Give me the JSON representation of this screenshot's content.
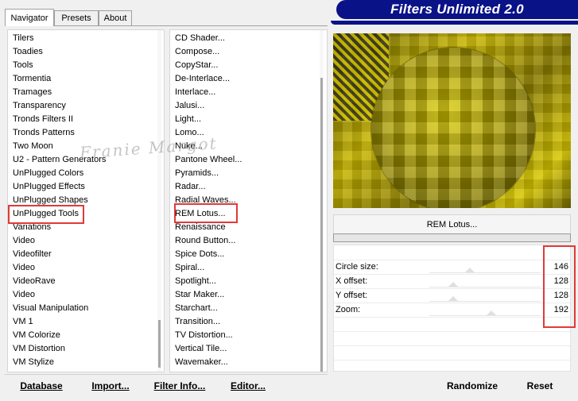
{
  "tabs": [
    {
      "label": "Navigator",
      "active": true
    },
    {
      "label": "Presets",
      "active": false
    },
    {
      "label": "About",
      "active": false
    }
  ],
  "banner": {
    "title": "Filters Unlimited 2.0"
  },
  "categories": [
    "Tilers",
    "Toadies",
    "Tools",
    "Tormentia",
    "Tramages",
    "Transparency",
    "Tronds Filters II",
    "Tronds Patterns",
    "Two Moon",
    "U2 - Pattern Generators",
    "UnPlugged Colors",
    "UnPlugged Effects",
    "UnPlugged Shapes",
    "UnPlugged Tools",
    "Variations",
    "Video",
    "Videofilter",
    "Video",
    "VideoRave",
    "Video",
    "Visual Manipulation",
    "VM 1",
    "VM Colorize",
    "VM Distortion",
    "VM Stylize"
  ],
  "selected_category": "UnPlugged Tools",
  "filters": [
    "CD Shader...",
    "Compose...",
    "CopyStar...",
    "De-Interlace...",
    "Interlace...",
    "Jalusi...",
    "Light...",
    "Lomo...",
    "Nuke...",
    "Pantone Wheel...",
    "Pyramids...",
    "Radar...",
    "Radial Waves...",
    "REM Lotus...",
    "Renaissance",
    "Round Button...",
    "Spice Dots...",
    "Spiral...",
    "Spotlight...",
    "Star Maker...",
    "Starchart...",
    "Transition...",
    "TV Distortion...",
    "Vertical Tile...",
    "Wavemaker..."
  ],
  "selected_filter": "REM Lotus...",
  "filter_name": "REM Lotus...",
  "params": [
    {
      "label": "Circle size:",
      "value": "146"
    },
    {
      "label": "X offset:",
      "value": "128"
    },
    {
      "label": "Y offset:",
      "value": "128"
    },
    {
      "label": "Zoom:",
      "value": "192"
    }
  ],
  "buttons": {
    "database": "Database",
    "import": "Import...",
    "filter_info": "Filter Info...",
    "editor": "Editor...",
    "randomize": "Randomize",
    "reset": "Reset"
  },
  "watermark": "Franie Margot",
  "colors": {
    "banner": "#0a1287",
    "highlight_box": "#e03a3a",
    "preview_yellow": "#c8b600"
  }
}
